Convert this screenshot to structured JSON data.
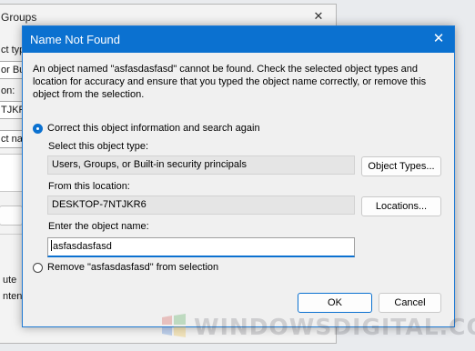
{
  "background_window": {
    "title": "Groups",
    "text_1": "ct type",
    "text_2": "or Bu",
    "text_3": "on:",
    "text_4": "TJKRG",
    "text_5": "ct name",
    "text_6": "ute",
    "text_7": "ntents"
  },
  "dialog": {
    "title": "Name Not Found",
    "message": "An object named \"asfasdasfasd\" cannot be found. Check the selected object types and location for accuracy and ensure that you typed the object name correctly, or remove this object from the selection.",
    "option_correct": {
      "label": "Correct this object information and search again",
      "selected": true
    },
    "object_type": {
      "label": "Select this object type:",
      "value": "Users, Groups, or Built-in security principals",
      "button": "Object Types..."
    },
    "location": {
      "label": "From this location:",
      "value": "DESKTOP-7NTJKR6",
      "button": "Locations..."
    },
    "object_name": {
      "label": "Enter the object name:",
      "value": "asfasdasfasd"
    },
    "option_remove": {
      "label": "Remove \"asfasdasfasd\" from selection",
      "selected": false
    },
    "ok_button": "OK",
    "cancel_button": "Cancel"
  },
  "watermark": {
    "text": "WINDOWSDIGITAL.COM"
  },
  "colors": {
    "accent": "#0b71d0",
    "dialog_bg": "#f0f0f0",
    "readonly_bg": "#e5e5e5"
  },
  "icons": {
    "close": "close-icon",
    "watermark_logo": "windows-logo-icon"
  }
}
